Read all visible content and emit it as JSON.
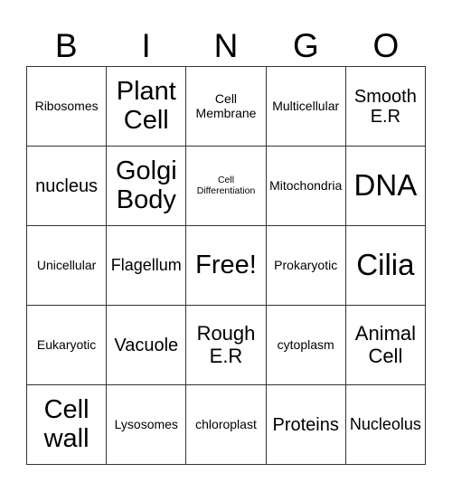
{
  "header": [
    "B",
    "I",
    "N",
    "G",
    "O"
  ],
  "cells": [
    [
      "Ribosomes",
      "Plant Cell",
      "Cell Membrane",
      "Multicellular",
      "Smooth E.R"
    ],
    [
      "nucleus",
      "Golgi Body",
      "Cell Differentiation",
      "Mitochondria",
      "DNA"
    ],
    [
      "Unicellular",
      "Flagellum",
      "Free!",
      "Prokaryotic",
      "Cilia"
    ],
    [
      "Eukaryotic",
      "Vacuole",
      "Rough E.R",
      "cytoplasm",
      "Animal Cell"
    ],
    [
      "Cell wall",
      "Lysosomes",
      "chloroplast",
      "Proteins",
      "Nucleolus"
    ]
  ]
}
